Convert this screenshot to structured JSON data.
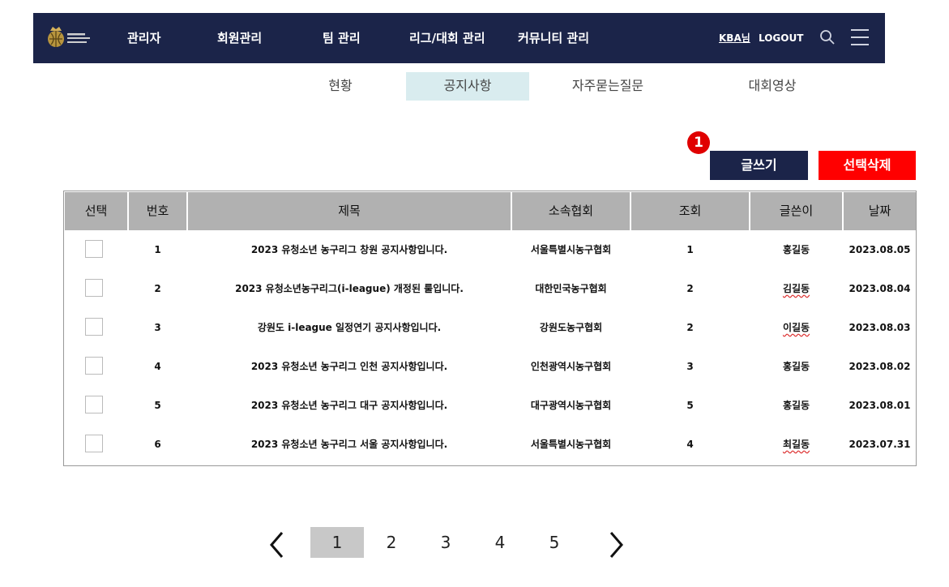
{
  "header": {
    "nav": [
      "관리자",
      "회원관리",
      "팀 관리",
      "리그/대회 관리",
      "커뮤니티 관리"
    ],
    "user": "KBA님",
    "logout": "LOGOUT",
    "icons": [
      "logo-emblem",
      "search-icon",
      "hamburger-menu-icon"
    ],
    "bar_color": "#1b2449"
  },
  "subtabs": [
    "현황",
    "공지사항",
    "자주묻는질문",
    "대회영상"
  ],
  "active_subtab": "공지사항",
  "badge": "1",
  "buttons": {
    "write": "글쓰기",
    "delete": "선택삭제"
  },
  "button_colors": {
    "write": "#1b2449",
    "delete": "#ff0000"
  },
  "table": {
    "columns": [
      "선택",
      "번호",
      "제목",
      "소속협회",
      "조회",
      "글쓴이",
      "날짜"
    ],
    "rows": [
      {
        "no": "1",
        "title": "2023 유청소년 농구리그 창원 공지사항입니다.",
        "assoc": "서울특별시농구협회",
        "views": "1",
        "author": "홍길동",
        "date": "2023.08.05"
      },
      {
        "no": "2",
        "title": "2023 유청소년농구리그(i-league) 개정된 룰입니다.",
        "assoc": "대한민국농구협회",
        "views": "2",
        "author": "김길동",
        "date": "2023.08.04"
      },
      {
        "no": "3",
        "title": "강원도 i-league 일정연기 공지사항입니다.",
        "assoc": "강원도농구협회",
        "views": "2",
        "author": "이길동",
        "date": "2023.08.03"
      },
      {
        "no": "4",
        "title": "2023 유청소년 농구리그 인천 공지사항입니다.",
        "assoc": "인천광역시농구협회",
        "views": "3",
        "author": "홍길동",
        "date": "2023.08.02"
      },
      {
        "no": "5",
        "title": "2023 유청소년 농구리그 대구 공지사항입니다.",
        "assoc": "대구광역시농구협회",
        "views": "5",
        "author": "홍길동",
        "date": "2023.08.01"
      },
      {
        "no": "6",
        "title": "2023 유청소년 농구리그 서울 공지사항입니다.",
        "assoc": "서울특별시농구협회",
        "views": "4",
        "author": "최길동",
        "date": "2023.07.31"
      }
    ]
  },
  "pagination": {
    "pages": [
      "1",
      "2",
      "3",
      "4",
      "5"
    ],
    "current": "1",
    "icons": [
      "chevron-left-icon",
      "chevron-right-icon"
    ]
  }
}
